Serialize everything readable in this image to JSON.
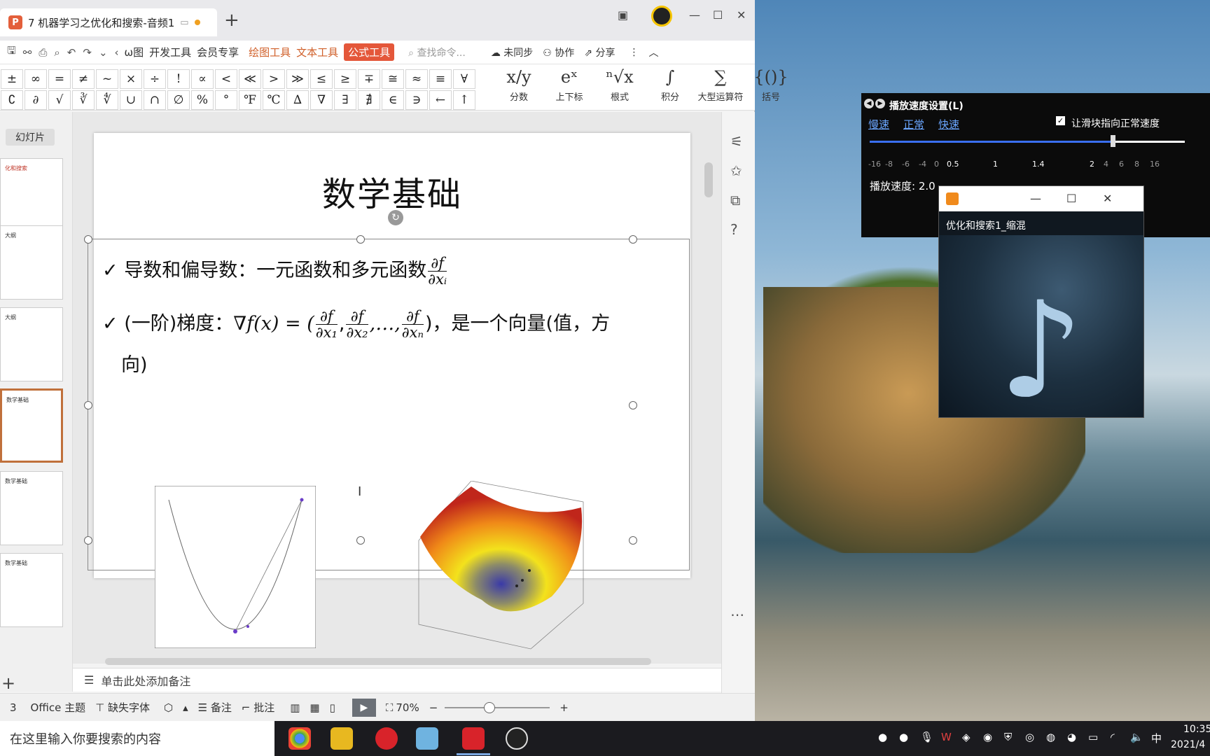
{
  "app": {
    "doc_tab_title": "7 机器学习之优化和搜索-音频1",
    "wps_logo": "P",
    "new_tab": "+"
  },
  "ribbon": {
    "tabs": [
      "ω图",
      "开发工具",
      "会员专享",
      "绘图工具",
      "文本工具",
      "公式工具"
    ],
    "search_placeholder": "查找命令...",
    "sync": "未同步",
    "collab": "协作",
    "share": "分享"
  },
  "formula_toolbar": {
    "symbols_row1": [
      "±",
      "∞",
      "=",
      "≠",
      "~",
      "×",
      "÷",
      "!",
      "∝",
      "<",
      "≪",
      ">",
      "≫",
      "≤",
      "≥",
      "∓",
      "≅",
      "≈",
      "≡",
      "∀"
    ],
    "symbols_row2": [
      "∁",
      "∂",
      "√",
      "∛",
      "∜",
      "∪",
      "∩",
      "∅",
      "%",
      "°",
      "℉",
      "℃",
      "∆",
      "∇",
      "∃",
      "∄",
      "∈",
      "∋",
      "←",
      "↑"
    ],
    "tools": [
      {
        "icon": "x/y",
        "label": "分数"
      },
      {
        "icon": "eˣ",
        "label": "上下标"
      },
      {
        "icon": "ⁿ√x",
        "label": "根式"
      },
      {
        "icon": "∫",
        "label": "积分"
      },
      {
        "icon": "∑",
        "label": "大型运算符"
      },
      {
        "icon": "{()}",
        "label": "括号"
      }
    ]
  },
  "thumbnails": {
    "tab_label": "幻灯片",
    "items": [
      "化和搜索",
      "大纲",
      "大纲",
      "数学基础",
      "数学基础",
      "数学基础"
    ]
  },
  "slide": {
    "title": "数学基础",
    "bullet1_text": "导数和偏导数：一元函数和多元函数",
    "bullet1_frac_num": "∂f",
    "bullet1_frac_den": "∂xᵢ",
    "bullet2_prefix": "(一阶)梯度：",
    "bullet2_formula": "∇f(x) = (",
    "bullet2_frac1_den": "∂x₁",
    "bullet2_frac2_den": "∂x₂",
    "bullet2_ellipsis": ",…,",
    "bullet2_fracn_den": "∂xₙ",
    "bullet2_suffix": ")，是一个向量(值，方",
    "bullet2_cont": "向)",
    "check": "✓"
  },
  "notes": {
    "placeholder": "单击此处添加备注"
  },
  "statusbar": {
    "slide_num": "3",
    "theme": "Office 主题",
    "missing_font": "缺失字体",
    "notes": "备注",
    "comments": "批注",
    "zoom": "70%"
  },
  "speed_panel": {
    "title": "播放速度设置(L)",
    "slow": "慢速",
    "normal": "正常",
    "fast": "快速",
    "checkbox_label": "让滑块指向正常速度",
    "checkbox_checked": true,
    "ticks": [
      "-16",
      "-8",
      "-6",
      "-4",
      "0",
      "0.5",
      "1",
      "1.4",
      "2",
      "4",
      "6",
      "8",
      "16"
    ],
    "speed_text": "播放速度: 2.0",
    "slider_fraction": 0.78
  },
  "player": {
    "title": "优化和搜索1_缩混"
  },
  "taskbar": {
    "search_placeholder": "在这里输入你要搜索的内容",
    "ime": "中",
    "time": "10:35",
    "date": "2021/4"
  }
}
